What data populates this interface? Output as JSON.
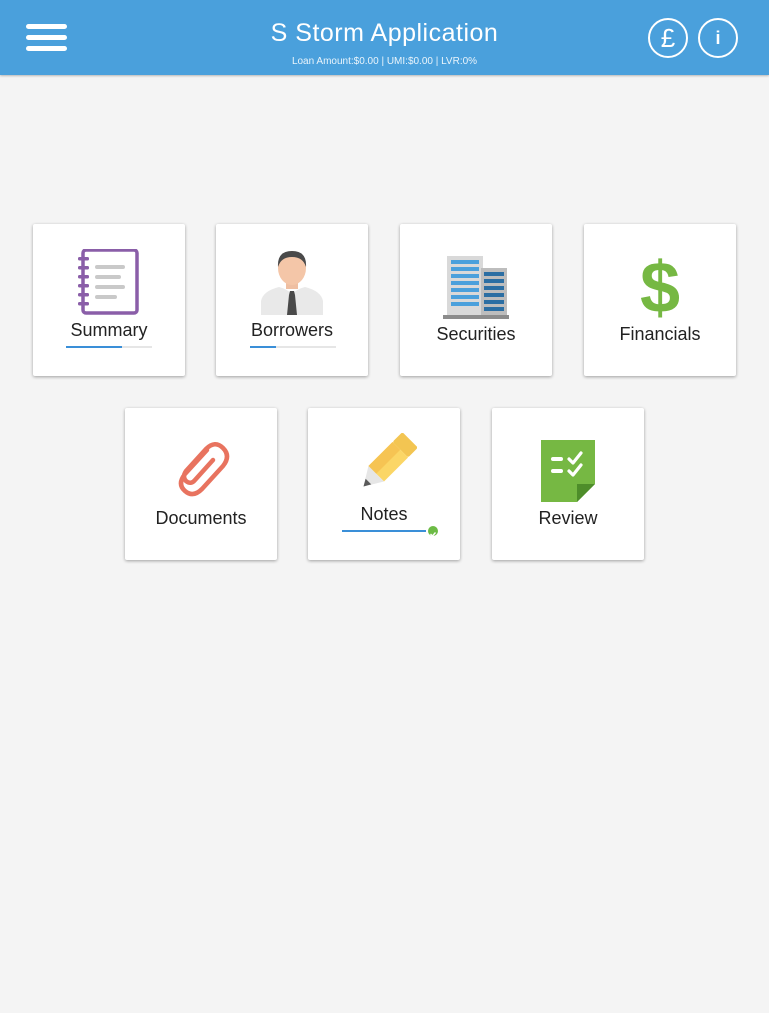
{
  "header": {
    "title": "S Storm Application",
    "subtitle": "Loan Amount:$0.00 | UMI:$0.00 | LVR:0%",
    "currency_symbol": "£",
    "info_symbol": "i",
    "background_color": "#4aa0dc"
  },
  "tiles": [
    {
      "label": "Summary",
      "icon": "notebook-icon",
      "progress": 0.65
    },
    {
      "label": "Borrowers",
      "icon": "person-icon",
      "progress": 0.3
    },
    {
      "label": "Securities",
      "icon": "building-icon"
    },
    {
      "label": "Financials",
      "icon": "dollar-icon"
    },
    {
      "label": "Documents",
      "icon": "paperclip-icon"
    },
    {
      "label": "Notes",
      "icon": "pencil-icon",
      "progress": 1.0,
      "complete": true
    },
    {
      "label": "Review",
      "icon": "checklist-icon"
    }
  ]
}
